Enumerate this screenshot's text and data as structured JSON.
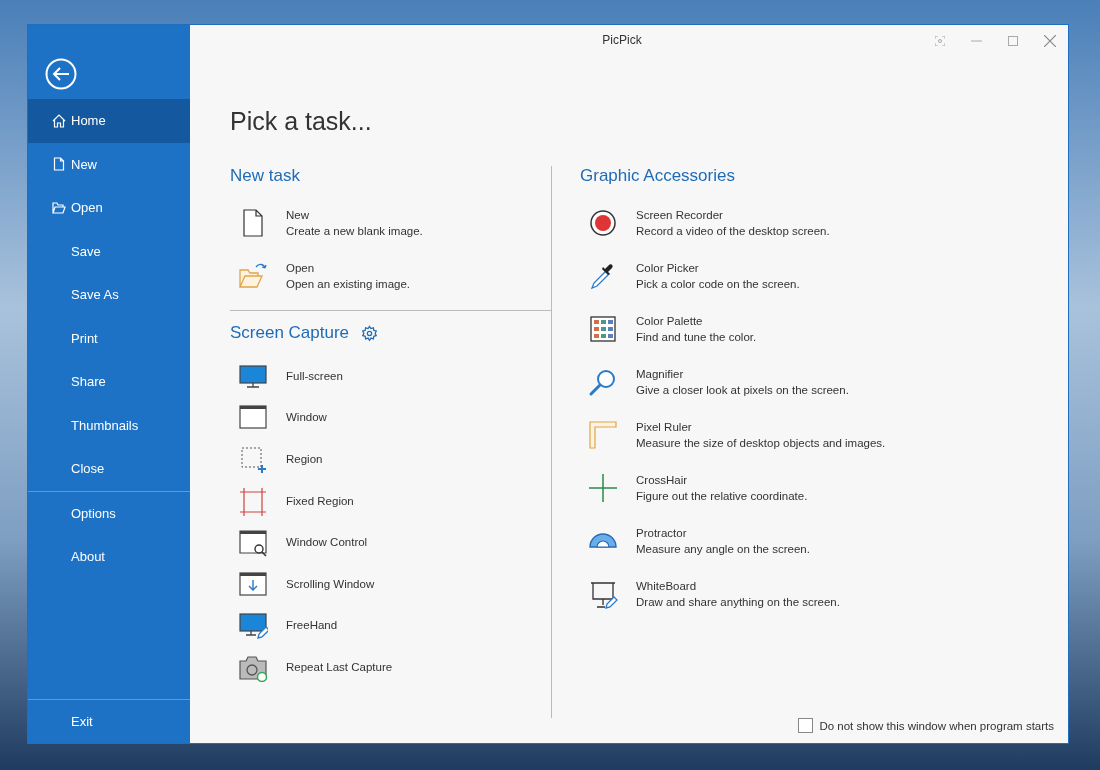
{
  "window": {
    "title": "PicPick"
  },
  "sidebar": {
    "groups": [
      [
        {
          "label": "Home",
          "kind": "home",
          "selected": true
        },
        {
          "label": "New",
          "kind": "new",
          "selected": false
        },
        {
          "label": "Open",
          "kind": "open",
          "selected": false
        },
        {
          "label": "Save",
          "kind": "plain",
          "selected": false
        },
        {
          "label": "Save As",
          "kind": "plain",
          "selected": false
        },
        {
          "label": "Print",
          "kind": "plain",
          "selected": false
        },
        {
          "label": "Share",
          "kind": "plain",
          "selected": false
        },
        {
          "label": "Thumbnails",
          "kind": "plain",
          "selected": false
        },
        {
          "label": "Close",
          "kind": "plain",
          "selected": false
        }
      ],
      [
        {
          "label": "Options",
          "kind": "plain",
          "selected": false
        },
        {
          "label": "About",
          "kind": "plain",
          "selected": false
        }
      ]
    ],
    "exit": "Exit"
  },
  "heading": "Pick a task...",
  "new_task": {
    "title": "New task",
    "items": [
      {
        "kind": "new",
        "name": "New",
        "description": "Create a new blank image."
      },
      {
        "kind": "open",
        "name": "Open",
        "description": "Open an existing image."
      }
    ]
  },
  "screen_capture": {
    "title": "Screen Capture",
    "items": [
      {
        "kind": "fullscreen",
        "name": "Full-screen"
      },
      {
        "kind": "window",
        "name": "Window"
      },
      {
        "kind": "region",
        "name": "Region"
      },
      {
        "kind": "fixed",
        "name": "Fixed Region"
      },
      {
        "kind": "control",
        "name": "Window Control"
      },
      {
        "kind": "scrolling",
        "name": "Scrolling Window"
      },
      {
        "kind": "freehand",
        "name": "FreeHand"
      },
      {
        "kind": "repeat",
        "name": "Repeat Last Capture"
      }
    ]
  },
  "graphic_accessories": {
    "title": "Graphic Accessories",
    "items": [
      {
        "kind": "recorder",
        "name": "Screen Recorder",
        "description": "Record a video of the desktop screen."
      },
      {
        "kind": "picker",
        "name": "Color Picker",
        "description": "Pick a color code on the screen."
      },
      {
        "kind": "palette",
        "name": "Color Palette",
        "description": "Find and tune the color."
      },
      {
        "kind": "magnifier",
        "name": "Magnifier",
        "description": "Give a closer look at pixels on the screen."
      },
      {
        "kind": "ruler",
        "name": "Pixel Ruler",
        "description": "Measure the size of desktop objects and images."
      },
      {
        "kind": "crosshair",
        "name": "CrossHair",
        "description": "Figure out the relative coordinate."
      },
      {
        "kind": "protractor",
        "name": "Protractor",
        "description": "Measure any angle on the screen."
      },
      {
        "kind": "whiteboard",
        "name": "WhiteBoard",
        "description": "Draw and share anything on the screen."
      }
    ]
  },
  "startup_option": {
    "label": "Do not show this window when program starts",
    "checked": false
  }
}
